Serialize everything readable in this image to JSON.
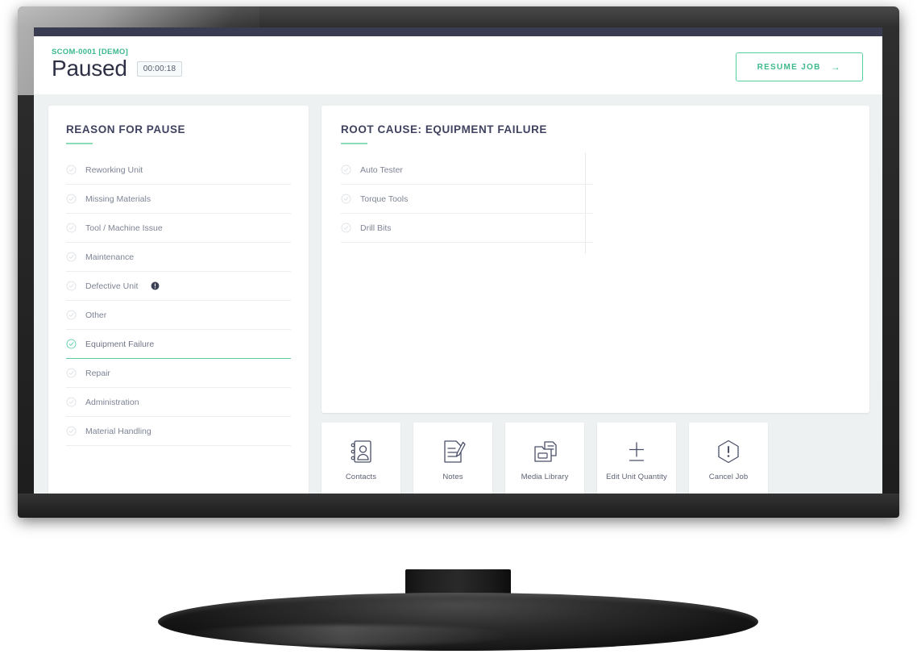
{
  "header": {
    "job_code": "SCOM-0001 [DEMO]",
    "status": "Paused",
    "timer": "00:00:18",
    "resume_label": "RESUME JOB",
    "resume_arrow": "→",
    "accent_color": "#3bb98b",
    "status_color": "#2e3146"
  },
  "reason_panel": {
    "title": "REASON FOR PAUSE",
    "items": [
      {
        "label": "Reworking Unit",
        "selected": false,
        "badge": false
      },
      {
        "label": "Missing Materials",
        "selected": false,
        "badge": false
      },
      {
        "label": "Tool / Machine Issue",
        "selected": false,
        "badge": false
      },
      {
        "label": "Maintenance",
        "selected": false,
        "badge": false
      },
      {
        "label": "Defective Unit",
        "selected": false,
        "badge": true
      },
      {
        "label": "Other",
        "selected": false,
        "badge": false
      },
      {
        "label": "Equipment Failure",
        "selected": true,
        "badge": false
      },
      {
        "label": "Repair",
        "selected": false,
        "badge": false
      },
      {
        "label": "Administration",
        "selected": false,
        "badge": false
      },
      {
        "label": "Material Handling",
        "selected": false,
        "badge": false
      }
    ]
  },
  "root_cause_panel": {
    "title": "ROOT CAUSE: EQUIPMENT FAILURE",
    "items": [
      {
        "label": "Auto Tester",
        "selected": false
      },
      {
        "label": "Torque Tools",
        "selected": false
      },
      {
        "label": "Drill Bits",
        "selected": false
      }
    ]
  },
  "actions": [
    {
      "label": "Contacts",
      "icon": "contacts-icon"
    },
    {
      "label": "Notes",
      "icon": "notes-icon"
    },
    {
      "label": "Media Library",
      "icon": "media-library-icon"
    },
    {
      "label": "Edit Unit Quantity",
      "icon": "plus-minus-icon"
    },
    {
      "label": "Cancel Job",
      "icon": "cancel-job-icon"
    }
  ],
  "theme": {
    "accent_green": "#5ccd9d",
    "accent_light": "#8edcb6",
    "navy": "#3a3c52",
    "page_bg": "#eef1f2"
  }
}
